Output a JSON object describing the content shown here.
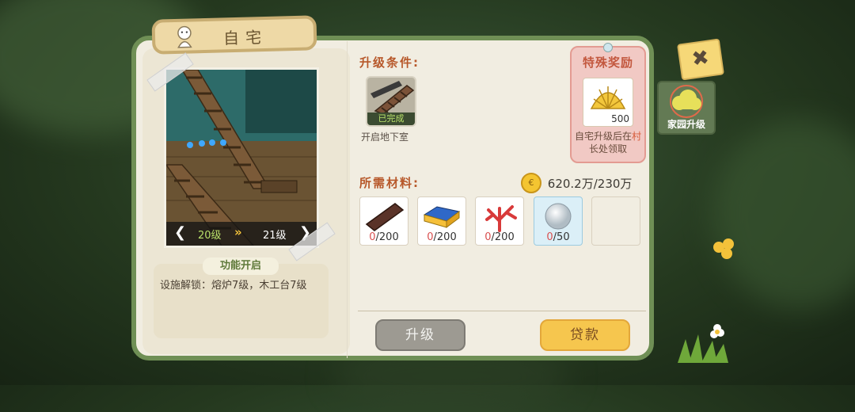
{
  "window": {
    "title": "自宅"
  },
  "preview": {
    "current_level": "20级",
    "next_level": "21级"
  },
  "function_unlock": {
    "heading": "功能开启",
    "text": "设施解锁：熔炉7级，木工台7级"
  },
  "upgrade_conditions": {
    "label": "升级条件:",
    "items": [
      {
        "name": "开启地下室",
        "status": "已完成",
        "icon": "basement-stairs-icon"
      }
    ]
  },
  "special_reward": {
    "title": "特殊奖励",
    "item": {
      "icon": "golden-shell-icon",
      "count": "500"
    },
    "desc_part1": "自宅升级后在",
    "desc_highlight": "村",
    "desc_part2": "长处领取"
  },
  "materials": {
    "label": "所需材料:",
    "coins": "620.2万/230万",
    "items": [
      {
        "icon": "wood-plank-icon",
        "have": "0",
        "need": "/200"
      },
      {
        "icon": "gold-bar-icon",
        "have": "0",
        "need": "/200"
      },
      {
        "icon": "red-coral-icon",
        "have": "0",
        "need": "/200"
      },
      {
        "icon": "pearl-icon",
        "have": "0",
        "need": "/50"
      }
    ]
  },
  "buttons": {
    "upgrade": "升级",
    "loan": "贷款"
  },
  "side_tab": {
    "label": "家园升级"
  },
  "colors": {
    "panel_border": "#6f8f55",
    "accent_orange": "#b7582a",
    "loan_yellow": "#f6c64e"
  }
}
